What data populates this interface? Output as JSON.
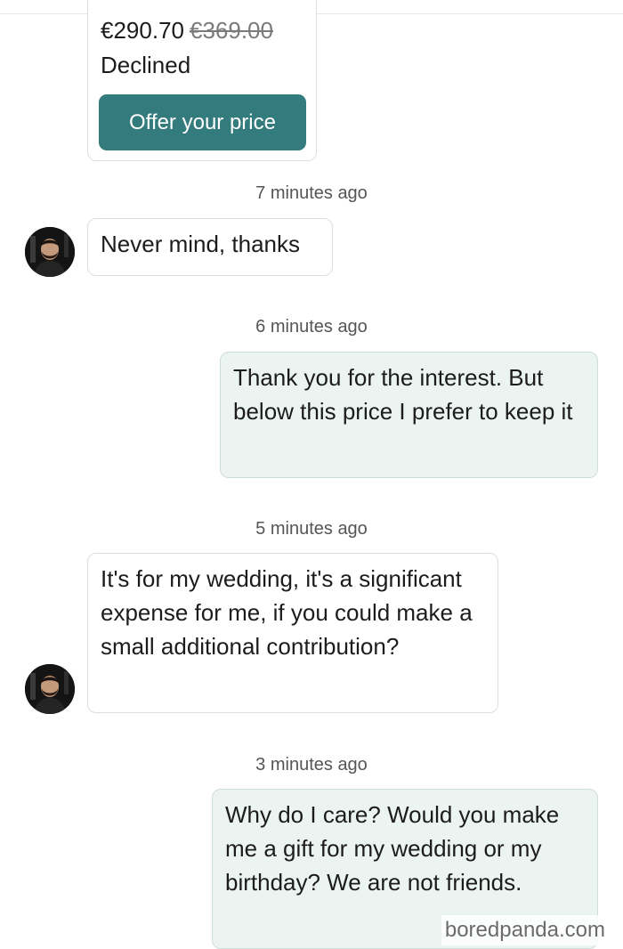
{
  "offer": {
    "price_current": "€290.70",
    "price_original": "€369.00",
    "status": "Declined",
    "button_label": "Offer your price"
  },
  "messages": [
    {
      "time": "7 minutes ago",
      "direction": "incoming",
      "text": "Never mind, thanks",
      "avatar": "user-avatar"
    },
    {
      "time": "6 minutes ago",
      "direction": "outgoing",
      "text": "Thank you for the interest. But below this price I prefer to keep it"
    },
    {
      "time": "5 minutes ago",
      "direction": "incoming",
      "text": "It's for my wedding, it's a significant expense for me, if you could make a small additional contribution?",
      "avatar": "user-avatar"
    },
    {
      "time": "3 minutes ago",
      "direction": "outgoing",
      "text": "Why do I care? Would you make me a gift for my wedding or my birthday? We are not friends."
    }
  ],
  "watermark": "boredpanda.com",
  "colors": {
    "accent": "#347b7d",
    "outgoing_bubble": "#ecf4f1",
    "incoming_bubble": "#ffffff",
    "timestamp_text": "#555555"
  }
}
